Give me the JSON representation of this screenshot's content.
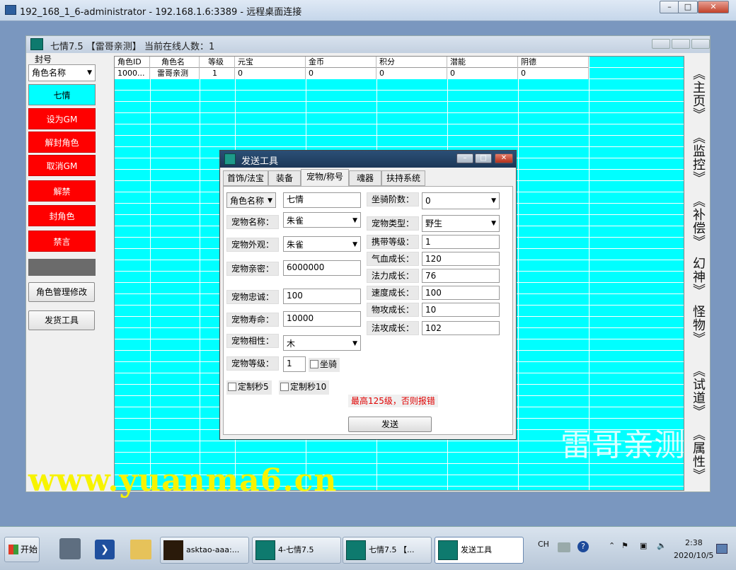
{
  "rdp": {
    "title": "192_168_1_6-administrator - 192.168.1.6:3389 - 远程桌面连接",
    "min": "–",
    "max": "□",
    "close": "✕"
  },
  "app": {
    "title": "七情7.5 【雷哥亲测】 当前在线人数：1"
  },
  "left": {
    "section": "封号",
    "combo_value": "角色名称",
    "selected": "七情",
    "buttons": [
      "设为GM",
      "解封角色",
      "取消GM",
      "解禁",
      "封角色",
      "禁言"
    ],
    "manage": "角色管理修改",
    "ship": "发货工具"
  },
  "grid": {
    "headers": [
      "角色ID",
      "角色名",
      "等级",
      "元宝",
      "金币",
      "积分",
      "潜能",
      "阴德"
    ],
    "row": [
      "1000...",
      "雷哥亲测",
      "1",
      "0",
      "0",
      "0",
      "0",
      "0"
    ]
  },
  "nav": [
    "《主页》",
    "《监控》",
    "《补偿》",
    "幻神》",
    "怪物》",
    "《试道》",
    "《属性》"
  ],
  "dialog": {
    "title": "发送工具",
    "tabs": [
      "首饰/法宝",
      "装备",
      "宠物/称号",
      "魂器",
      "扶持系统"
    ],
    "fields": {
      "role_select": "角色名称",
      "role_value": "七情",
      "pet_name_lbl": "宠物名称：",
      "pet_name": "朱雀",
      "pet_look_lbl": "宠物外观：",
      "pet_look": "朱雀",
      "pet_intimacy_lbl": "宠物亲密：",
      "pet_intimacy": "6000000",
      "pet_loyalty_lbl": "宠物忠诚：",
      "pet_loyalty": "100",
      "pet_life_lbl": "宠物寿命：",
      "pet_life": "10000",
      "pet_phase_lbl": "宠物相性：",
      "pet_phase": "木",
      "pet_level_lbl": "宠物等级：",
      "pet_level": "1",
      "mount_lbl": "坐骑",
      "mount_stage_lbl": "坐骑阶数：",
      "mount_stage": "0",
      "pet_type_lbl": "宠物类型：",
      "pet_type": "野生",
      "carry_lbl": "携带等级：",
      "carry": "1",
      "hp_lbl": "气血成长：",
      "hp": "120",
      "mp_lbl": "法力成长：",
      "mp": "76",
      "speed_lbl": "速度成长：",
      "speed": "100",
      "phy_lbl": "物攻成长：",
      "phy": "10",
      "mag_lbl": "法攻成长：",
      "mag": "102",
      "warn": "最高125级，否则报错",
      "sec5": "定制秒5",
      "sec10": "定制秒10",
      "send": "发送"
    }
  },
  "watermarks": {
    "url": "www.yuanma6.cn",
    "name": "雷哥亲测"
  },
  "taskbar": {
    "start": "开始",
    "items": [
      "asktao-aaa:...",
      "4-七情7.5",
      "七情7.5 【...",
      "发送工具"
    ],
    "lang": "CH",
    "time": "2:38",
    "date": "2020/10/5"
  }
}
